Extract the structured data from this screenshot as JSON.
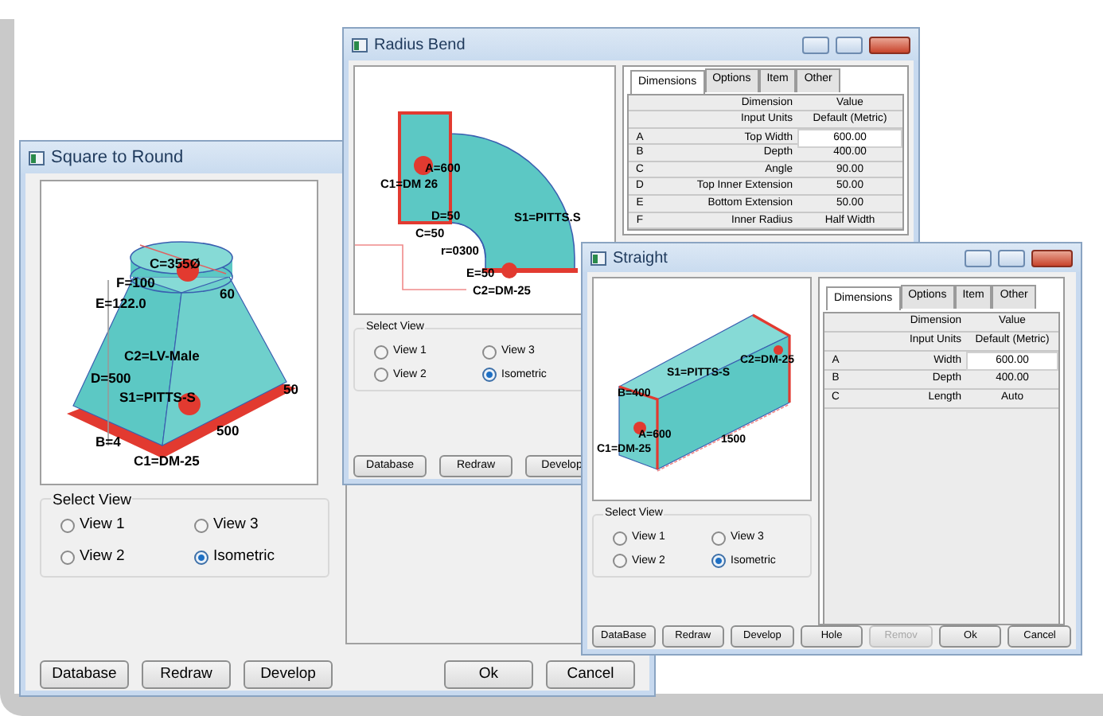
{
  "windows": [
    {
      "title": "Square to Round",
      "title_bar_buttons": false,
      "drawing": {
        "kind": "transition",
        "labels": [
          "C=355Ø",
          "F=100",
          "60",
          "E=122.0",
          "C2=LV-Male",
          "D=500",
          "S1=PITTS-S",
          "50",
          "500",
          "B=4",
          "C1=DM-25"
        ]
      },
      "select_view": {
        "label": "Select View",
        "options": [
          {
            "label": "View 1",
            "selected": false
          },
          {
            "label": "View 3",
            "selected": false
          },
          {
            "label": "View 2",
            "selected": false
          },
          {
            "label": "Isometric",
            "selected": true
          }
        ]
      },
      "buttons": [
        {
          "label": "Database",
          "disabled": false
        },
        {
          "label": "Redraw",
          "disabled": false
        },
        {
          "label": "Develop",
          "disabled": false
        }
      ],
      "dialog_buttons": [
        {
          "label": "Ok",
          "disabled": false
        },
        {
          "label": "Cancel",
          "disabled": false
        }
      ]
    },
    {
      "title": "Radius Bend",
      "title_bar_buttons": true,
      "drawing": {
        "kind": "bend",
        "labels": [
          "A=600",
          "C1=DM 26",
          "D=50",
          "S1=PITTS.S",
          "C=50",
          "r=0300",
          "E=50",
          "C2=DM-25"
        ]
      },
      "tabs": [
        {
          "label": "Dimensions",
          "selected": true
        },
        {
          "label": "Options",
          "selected": false
        },
        {
          "label": "Item",
          "selected": false
        },
        {
          "label": "Other",
          "selected": false
        }
      ],
      "table": {
        "columns": [
          "Dimension",
          "Value"
        ],
        "units_row": {
          "label": "Input Units",
          "value": "Default (Metric)"
        },
        "rows": [
          {
            "letter": "A",
            "dimension": "Top Width",
            "value": "600.00",
            "editing": true
          },
          {
            "letter": "B",
            "dimension": "Depth",
            "value": "400.00",
            "editing": false
          },
          {
            "letter": "C",
            "dimension": "Angle",
            "value": "90.00",
            "editing": false
          },
          {
            "letter": "D",
            "dimension": "Top Inner Extension",
            "value": "50.00",
            "editing": false
          },
          {
            "letter": "E",
            "dimension": "Bottom Extension",
            "value": "50.00",
            "editing": false
          },
          {
            "letter": "F",
            "dimension": "Inner Radius",
            "value": "Half Width",
            "editing": false
          }
        ]
      },
      "select_view": {
        "label": "Select View",
        "options": [
          {
            "label": "View 1",
            "selected": false
          },
          {
            "label": "View 3",
            "selected": false
          },
          {
            "label": "View 2",
            "selected": false
          },
          {
            "label": "Isometric",
            "selected": true
          }
        ]
      },
      "buttons": [
        {
          "label": "Database",
          "disabled": false
        },
        {
          "label": "Redraw",
          "disabled": false
        },
        {
          "label": "Develop",
          "disabled": false
        }
      ]
    },
    {
      "title": "Straight",
      "title_bar_buttons": true,
      "drawing": {
        "kind": "straight",
        "labels": [
          "S1=PITTS-S",
          "C2=DM-25",
          "B=400",
          "A=600",
          "1500",
          "C1=DM-25"
        ]
      },
      "tabs": [
        {
          "label": "Dimensions",
          "selected": true
        },
        {
          "label": "Options",
          "selected": false
        },
        {
          "label": "Item",
          "selected": false
        },
        {
          "label": "Other",
          "selected": false
        }
      ],
      "table": {
        "columns": [
          "Dimension",
          "Value"
        ],
        "units_row": {
          "label": "Input Units",
          "value": "Default (Metric)"
        },
        "rows": [
          {
            "letter": "A",
            "dimension": "Width",
            "value": "600.00",
            "editing": true
          },
          {
            "letter": "B",
            "dimension": "Depth",
            "value": "400.00",
            "editing": false
          },
          {
            "letter": "C",
            "dimension": "Length",
            "value": "Auto",
            "editing": false
          }
        ]
      },
      "select_view": {
        "label": "Select View",
        "options": [
          {
            "label": "View 1",
            "selected": false
          },
          {
            "label": "View 3",
            "selected": false
          },
          {
            "label": "View 2",
            "selected": false
          },
          {
            "label": "Isometric",
            "selected": true
          }
        ]
      },
      "buttons": [
        {
          "label": "DataBase",
          "disabled": false
        },
        {
          "label": "Redraw",
          "disabled": false
        },
        {
          "label": "Develop",
          "disabled": false
        },
        {
          "label": "Hole",
          "disabled": false
        },
        {
          "label": "Remov",
          "disabled": true
        },
        {
          "label": "Ok",
          "disabled": false
        },
        {
          "label": "Cancel",
          "disabled": false
        }
      ]
    }
  ]
}
